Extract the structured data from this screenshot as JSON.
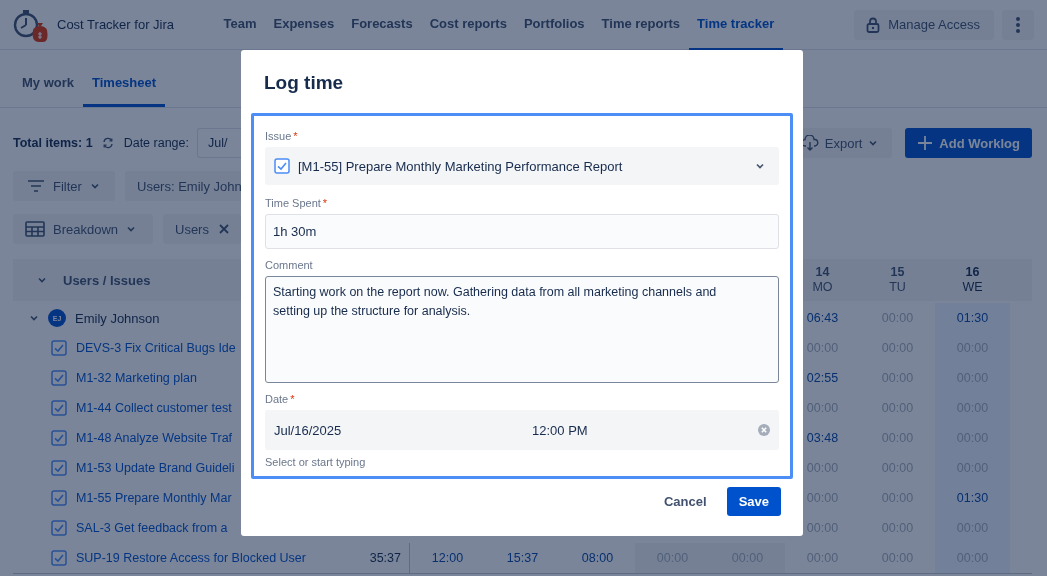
{
  "app": {
    "title": "Cost Tracker for Jira"
  },
  "nav": [
    {
      "label": "Team",
      "selected": false
    },
    {
      "label": "Expenses",
      "selected": false
    },
    {
      "label": "Forecasts",
      "selected": false
    },
    {
      "label": "Cost reports",
      "selected": false
    },
    {
      "label": "Portfolios",
      "selected": false
    },
    {
      "label": "Time reports",
      "selected": false
    },
    {
      "label": "Time tracker",
      "selected": true
    }
  ],
  "manage_access": "Manage Access",
  "subtabs": [
    {
      "label": "My work",
      "selected": false
    },
    {
      "label": "Timesheet",
      "selected": true
    }
  ],
  "toolbar": {
    "total_items": "Total items: 1",
    "date_range_label": "Date range:",
    "date_range_value": "Jul/",
    "export": "Export",
    "add_worklog": "Add Worklog"
  },
  "filters": {
    "filter_button": "Filter",
    "users_chip": "Users: Emily John"
  },
  "breakdown": {
    "button": "Breakdown",
    "chip": "Users"
  },
  "table": {
    "column_header": "Users / Issues",
    "days": [
      {
        "day": "14",
        "weekday": "MO",
        "today": false
      },
      {
        "day": "15",
        "weekday": "TU",
        "today": false
      },
      {
        "day": "16",
        "weekday": "WE",
        "today": true
      }
    ],
    "user": {
      "initials": "EJ",
      "name": "Emily Johnson",
      "expanded": true,
      "cells": [
        {
          "text": "06:43",
          "dimmed": false
        },
        {
          "text": "00:00",
          "dimmed": true
        },
        {
          "text": "01:30",
          "dimmed": false
        }
      ]
    },
    "rows": [
      {
        "checked": true,
        "issue": "DEVS-3 Fix Critical Bugs Ide",
        "cells": [
          {
            "text": "00:00",
            "dimmed": true
          },
          {
            "text": "00:00",
            "dimmed": true
          },
          {
            "text": "00:00",
            "dimmed": true
          }
        ]
      },
      {
        "checked": true,
        "issue": "M1-32 Marketing plan",
        "cells": [
          {
            "text": "02:55",
            "dimmed": false
          },
          {
            "text": "00:00",
            "dimmed": true
          },
          {
            "text": "00:00",
            "dimmed": true
          }
        ]
      },
      {
        "checked": true,
        "issue": "M1-44 Collect customer test",
        "cells": [
          {
            "text": "00:00",
            "dimmed": true
          },
          {
            "text": "00:00",
            "dimmed": true
          },
          {
            "text": "00:00",
            "dimmed": true
          }
        ]
      },
      {
        "checked": true,
        "issue": "M1-48 Analyze Website Traf",
        "cells": [
          {
            "text": "03:48",
            "dimmed": false
          },
          {
            "text": "00:00",
            "dimmed": true
          },
          {
            "text": "00:00",
            "dimmed": true
          }
        ]
      },
      {
        "checked": true,
        "issue": "M1-53 Update Brand Guideli",
        "cells": [
          {
            "text": "00:00",
            "dimmed": true
          },
          {
            "text": "00:00",
            "dimmed": true
          },
          {
            "text": "00:00",
            "dimmed": true
          }
        ]
      },
      {
        "checked": true,
        "issue": "M1-55 Prepare Monthly Mar",
        "cells": [
          {
            "text": "00:00",
            "dimmed": true
          },
          {
            "text": "00:00",
            "dimmed": true
          },
          {
            "text": "01:30",
            "dimmed": false
          }
        ]
      },
      {
        "checked": true,
        "issue": "SAL-3 Get feedback from a",
        "cells": [
          {
            "text": "00:00",
            "dimmed": true
          },
          {
            "text": "00:00",
            "dimmed": true
          },
          {
            "text": "00:00",
            "dimmed": true
          }
        ]
      },
      {
        "checked": true,
        "issue": "SUP-19 Restore Access for Blocked User",
        "total": "35:37",
        "cells": [
          {
            "text": "12:00",
            "dimmed": false
          },
          {
            "text": "15:37",
            "dimmed": false
          },
          {
            "text": "08:00",
            "dimmed": false
          },
          {
            "text": "00:00",
            "dimmed": true,
            "weekend": true
          },
          {
            "text": "00:00",
            "dimmed": true,
            "weekend": true
          },
          {
            "text": "00:00",
            "dimmed": true
          },
          {
            "text": "00:00",
            "dimmed": true
          },
          {
            "text": "00:00",
            "dimmed": true
          }
        ]
      }
    ]
  },
  "dialog": {
    "title": "Log time",
    "issue": {
      "label": "Issue",
      "required_mark": "*",
      "checked": true,
      "value": "[M1-55] Prepare Monthly Marketing Performance Report"
    },
    "time_spent": {
      "label": "Time Spent",
      "required_mark": "*",
      "value": "1h 30m"
    },
    "comment": {
      "label": "Comment",
      "value": "Starting work on the report now. Gathering data from all marketing channels and setting up the structure for analysis."
    },
    "date": {
      "label": "Date",
      "required_mark": "*",
      "date": "Jul/16/2025",
      "time": "12:00 PM",
      "helper": "Select or start typing"
    },
    "buttons": {
      "cancel": "Cancel",
      "save": "Save"
    }
  }
}
